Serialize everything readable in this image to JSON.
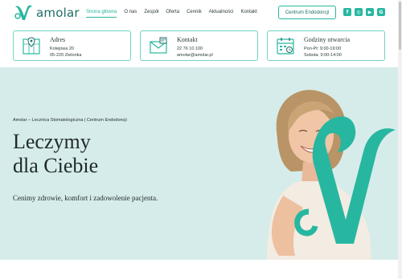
{
  "brand": {
    "name": "amolar",
    "accent": "#27b7a0",
    "dark_accent": "#1e6e66"
  },
  "nav": {
    "items": [
      {
        "label": "Strona główna",
        "active": true
      },
      {
        "label": "O nas"
      },
      {
        "label": "Zespół"
      },
      {
        "label": "Oferta"
      },
      {
        "label": "Cennik"
      },
      {
        "label": "Aktualności"
      },
      {
        "label": "Kontakt"
      }
    ],
    "cta_label": "Centrum Endodoncji",
    "socials": [
      "facebook-icon",
      "instagram-icon",
      "youtube-icon",
      "google-icon"
    ]
  },
  "info": {
    "address": {
      "title": "Adres",
      "line1": "Kolejowa 20",
      "line2": "05-220 Zielonka",
      "icon": "map-icon"
    },
    "contact": {
      "title": "Kontakt",
      "line1": "22 76 10 100",
      "line2": "amolar@amolar.pl",
      "icon": "envelope-icon"
    },
    "hours": {
      "title": "Godziny otwarcia",
      "line1": "Pon-Pt: 9:00-19:00",
      "line2": "Sobota: 9:00-14:00",
      "icon": "calendar-icon"
    }
  },
  "hero": {
    "subtitle": "Amolar – Lecznica Stomatologiczna | Centrum Endodoncji",
    "title_line1": "Leczymy",
    "title_line2": "dla Ciebie",
    "lead": "Cenimy zdrowie, komfort i zadowolenie pacjenta."
  }
}
